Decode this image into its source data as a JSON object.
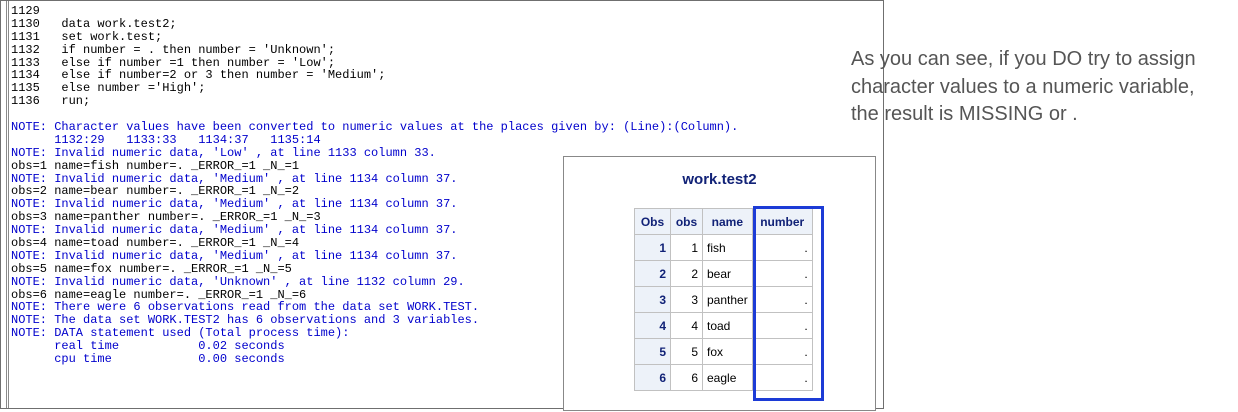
{
  "log": {
    "lines": [
      {
        "text": "1129",
        "type": "code"
      },
      {
        "text": "1130   data work.test2;",
        "type": "code"
      },
      {
        "text": "1131   set work.test;",
        "type": "code"
      },
      {
        "text": "1132   if number = . then number = 'Unknown';",
        "type": "code"
      },
      {
        "text": "1133   else if number =1 then number = 'Low';",
        "type": "code"
      },
      {
        "text": "1134   else if number=2 or 3 then number = 'Medium';",
        "type": "code"
      },
      {
        "text": "1135   else number ='High';",
        "type": "code"
      },
      {
        "text": "1136   run;",
        "type": "code"
      },
      {
        "text": "",
        "type": "code"
      },
      {
        "text": "NOTE: Character values have been converted to numeric values at the places given by: (Line):(Column).",
        "type": "note"
      },
      {
        "text": "      1132:29   1133:33   1134:37   1135:14",
        "type": "note"
      },
      {
        "text": "NOTE: Invalid numeric data, 'Low' , at line 1133 column 33.",
        "type": "note"
      },
      {
        "text": "obs=1 name=fish number=. _ERROR_=1 _N_=1",
        "type": "code"
      },
      {
        "text": "NOTE: Invalid numeric data, 'Medium' , at line 1134 column 37.",
        "type": "note"
      },
      {
        "text": "obs=2 name=bear number=. _ERROR_=1 _N_=2",
        "type": "code"
      },
      {
        "text": "NOTE: Invalid numeric data, 'Medium' , at line 1134 column 37.",
        "type": "note"
      },
      {
        "text": "obs=3 name=panther number=. _ERROR_=1 _N_=3",
        "type": "code"
      },
      {
        "text": "NOTE: Invalid numeric data, 'Medium' , at line 1134 column 37.",
        "type": "note"
      },
      {
        "text": "obs=4 name=toad number=. _ERROR_=1 _N_=4",
        "type": "code"
      },
      {
        "text": "NOTE: Invalid numeric data, 'Medium' , at line 1134 column 37.",
        "type": "note"
      },
      {
        "text": "obs=5 name=fox number=. _ERROR_=1 _N_=5",
        "type": "code"
      },
      {
        "text": "NOTE: Invalid numeric data, 'Unknown' , at line 1132 column 29.",
        "type": "note"
      },
      {
        "text": "obs=6 name=eagle number=. _ERROR_=1 _N_=6",
        "type": "code"
      },
      {
        "text": "NOTE: There were 6 observations read from the data set WORK.TEST.",
        "type": "note"
      },
      {
        "text": "NOTE: The data set WORK.TEST2 has 6 observations and 3 variables.",
        "type": "note"
      },
      {
        "text": "NOTE: DATA statement used (Total process time):",
        "type": "note"
      },
      {
        "text": "      real time           0.02 seconds",
        "type": "note"
      },
      {
        "text": "      cpu time            0.00 seconds",
        "type": "note"
      }
    ]
  },
  "commentary": "As you can see, if you DO try to assign character values to a numeric variable, the result is MISSING or .",
  "output": {
    "title": "work.test2",
    "columns": [
      "Obs",
      "obs",
      "name",
      "number"
    ],
    "rows": [
      [
        "1",
        "1",
        "fish",
        "."
      ],
      [
        "2",
        "2",
        "bear",
        "."
      ],
      [
        "3",
        "3",
        "panther",
        "."
      ],
      [
        "4",
        "4",
        "toad",
        "."
      ],
      [
        "5",
        "5",
        "fox",
        "."
      ],
      [
        "6",
        "6",
        "eagle",
        "."
      ]
    ]
  },
  "colors": {
    "note": "#0000cc",
    "header_text": "#112277",
    "header_bg": "#edf2f9",
    "highlight": "#1c3bd6",
    "commentary": "#555555"
  }
}
